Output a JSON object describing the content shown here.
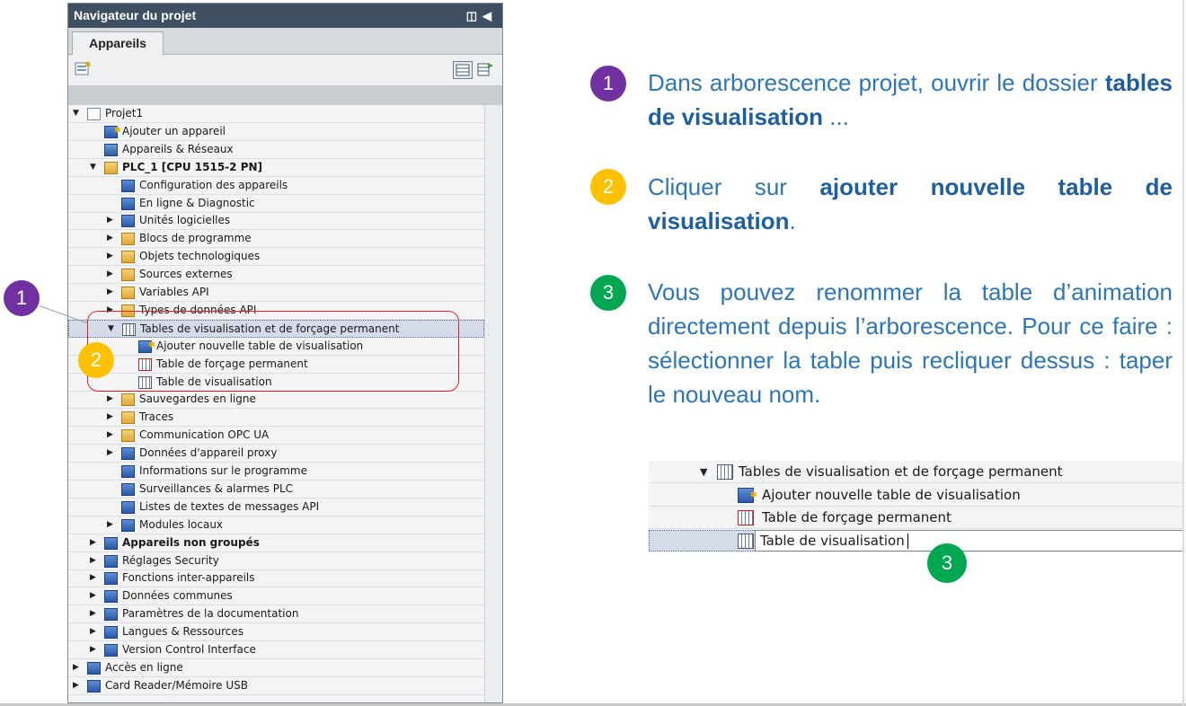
{
  "navigator": {
    "title": "Navigateur du projet",
    "tab": "Appareils",
    "tree": [
      {
        "label": "Projet1",
        "level": 0,
        "arrow": "▼",
        "icon": "project-icon"
      },
      {
        "label": "Ajouter un appareil",
        "level": 1,
        "arrow": "",
        "icon": "add-device-icon"
      },
      {
        "label": "Appareils & Réseaux",
        "level": 1,
        "arrow": "",
        "icon": "network-icon"
      },
      {
        "label": "PLC_1 [CPU 1515-2 PN]",
        "level": 1,
        "arrow": "▼",
        "icon": "plc-icon",
        "bold": true
      },
      {
        "label": "Configuration des appareils",
        "level": 2,
        "arrow": "",
        "icon": "device-config-icon"
      },
      {
        "label": "En ligne & Diagnostic",
        "level": 2,
        "arrow": "",
        "icon": "diagnostic-icon"
      },
      {
        "label": "Unités logicielles",
        "level": 2,
        "arrow": "▶",
        "icon": "software-units-icon"
      },
      {
        "label": "Blocs de programme",
        "level": 2,
        "arrow": "▶",
        "icon": "folder-icon"
      },
      {
        "label": "Objets technologiques",
        "level": 2,
        "arrow": "▶",
        "icon": "folder-icon"
      },
      {
        "label": "Sources externes",
        "level": 2,
        "arrow": "▶",
        "icon": "folder-icon"
      },
      {
        "label": "Variables API",
        "level": 2,
        "arrow": "▶",
        "icon": "folder-icon"
      },
      {
        "label": "Types de données API",
        "level": 2,
        "arrow": "▶",
        "icon": "folder-icon"
      },
      {
        "label": "Tables de visualisation et de forçage permanent",
        "level": 2,
        "arrow": "▼",
        "icon": "watch-folder-icon",
        "selected": true
      },
      {
        "label": "Ajouter nouvelle table de visualisation",
        "level": 3,
        "arrow": "",
        "icon": "add-watch-table-icon"
      },
      {
        "label": "Table de forçage permanent",
        "level": 3,
        "arrow": "",
        "icon": "force-table-icon"
      },
      {
        "label": "Table de visualisation",
        "level": 3,
        "arrow": "",
        "icon": "watch-table-icon"
      },
      {
        "label": "Sauvegardes en ligne",
        "level": 2,
        "arrow": "▶",
        "icon": "folder-icon"
      },
      {
        "label": "Traces",
        "level": 2,
        "arrow": "▶",
        "icon": "folder-icon"
      },
      {
        "label": "Communication OPC UA",
        "level": 2,
        "arrow": "▶",
        "icon": "folder-icon"
      },
      {
        "label": "Données d'appareil proxy",
        "level": 2,
        "arrow": "▶",
        "icon": "proxy-icon"
      },
      {
        "label": "Informations sur le programme",
        "level": 2,
        "arrow": "",
        "icon": "program-info-icon"
      },
      {
        "label": "Surveillances & alarmes PLC",
        "level": 2,
        "arrow": "",
        "icon": "alarms-icon"
      },
      {
        "label": "Listes de textes de messages API",
        "level": 2,
        "arrow": "",
        "icon": "text-list-icon"
      },
      {
        "label": "Modules locaux",
        "level": 2,
        "arrow": "▶",
        "icon": "local-modules-icon"
      },
      {
        "label": "Appareils non groupés",
        "level": 1,
        "arrow": "▶",
        "icon": "ungrouped-icon",
        "bold": true
      },
      {
        "label": "Réglages Security",
        "level": 1,
        "arrow": "▶",
        "icon": "security-icon"
      },
      {
        "label": "Fonctions inter-appareils",
        "level": 1,
        "arrow": "▶",
        "icon": "cross-device-icon"
      },
      {
        "label": "Données communes",
        "level": 1,
        "arrow": "▶",
        "icon": "common-data-icon"
      },
      {
        "label": "Paramètres de la documentation",
        "level": 1,
        "arrow": "▶",
        "icon": "documentation-icon"
      },
      {
        "label": "Langues & Ressources",
        "level": 1,
        "arrow": "▶",
        "icon": "languages-icon"
      },
      {
        "label": "Version Control Interface",
        "level": 1,
        "arrow": "▶",
        "icon": "version-control-icon"
      },
      {
        "label": "Accès en ligne",
        "level": 0,
        "arrow": "▶",
        "icon": "online-access-icon"
      },
      {
        "label": "Card Reader/Mémoire USB",
        "level": 0,
        "arrow": "▶",
        "icon": "card-reader-icon"
      }
    ]
  },
  "callouts": {
    "one": "1",
    "two": "2",
    "three": "3"
  },
  "steps": {
    "step1": {
      "num": "1",
      "pre": "Dans arborescence projet, ouvrir le dossier ",
      "bold": "tables de visualisation",
      "post": " ..."
    },
    "step2": {
      "num": "2",
      "pre": "Cliquer sur ",
      "bold": "ajouter nouvelle table de visualisation",
      "post": "."
    },
    "step3": {
      "num": "3",
      "text": "Vous pouvez renommer la table d’animation directement depuis l’arborescence. Pour ce faire : sélectionner la table puis recliquer dessus : taper le nouveau nom."
    }
  },
  "detail": {
    "folder": "Tables de visualisation et de forçage permanent",
    "add": "Ajouter nouvelle table de visualisation",
    "force": "Table de forçage permanent",
    "edit_value": "Table de visualisation"
  },
  "colors": {
    "purple": "#7030a0",
    "yellow": "#ffc000",
    "green": "#00a650",
    "instruction_text": "#2e75b6",
    "title_bar": "#3d4f61"
  }
}
